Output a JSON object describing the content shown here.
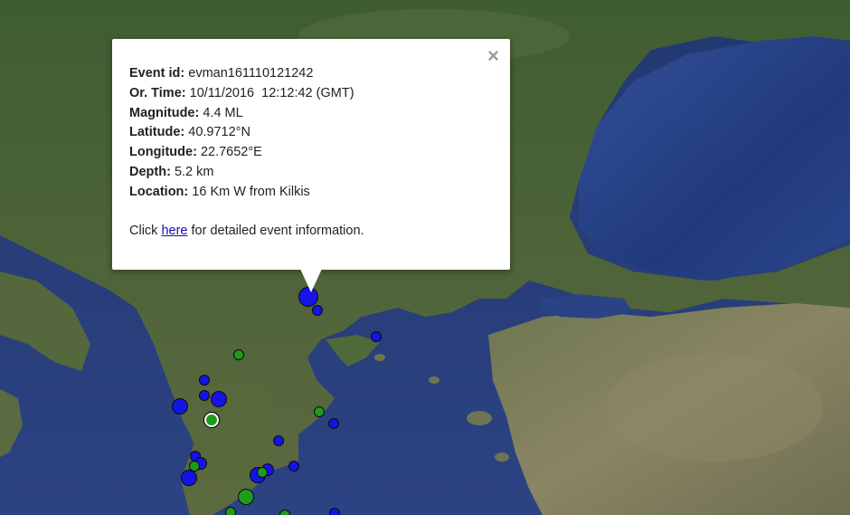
{
  "infowindow": {
    "close_glyph": "×",
    "fields": [
      {
        "label": "Event id:",
        "value": "evman161110121242"
      },
      {
        "label": "Or. Time:",
        "value": "10/11/2016  12:12:42 (GMT)"
      },
      {
        "label": "Magnitude:",
        "value": "4.4 ML"
      },
      {
        "label": "Latitude:",
        "value": "40.9712°N"
      },
      {
        "label": "Longitude:",
        "value": "22.7652°E"
      },
      {
        "label": "Depth:",
        "value": "5.2 km"
      },
      {
        "label": "Location:",
        "value": "16 Km W from Kilkis"
      }
    ],
    "footer_prefix": "Click ",
    "footer_link": "here",
    "footer_suffix": " for detailed event information."
  },
  "colors": {
    "marker_blue": "#1414e8",
    "marker_green": "#1f9a1f",
    "sea": "#2a3e7a",
    "land": "#4f6b3a"
  }
}
